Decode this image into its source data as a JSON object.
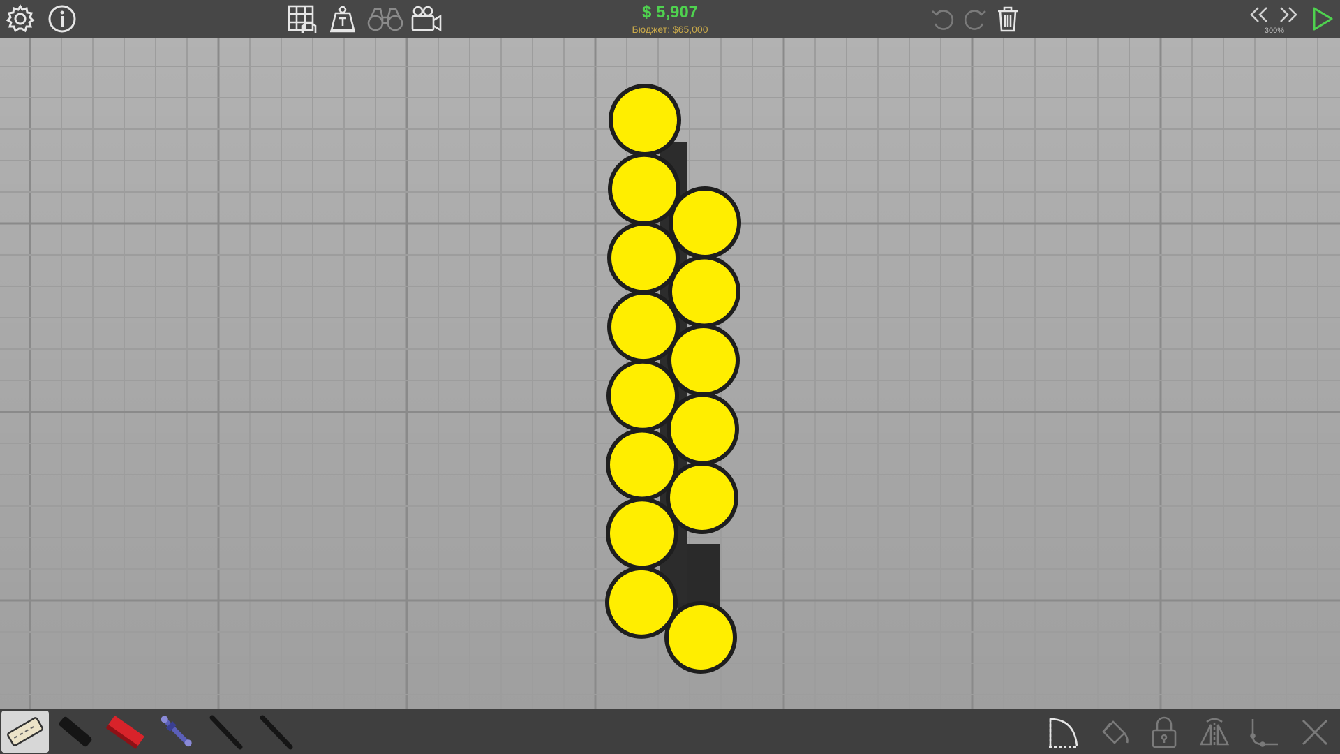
{
  "top_bar": {
    "money": "$ 5,907",
    "budget": "Бюджет: $65,000",
    "zoom": "300%",
    "icons": {
      "settings": "gear-icon",
      "info": "info-icon",
      "grid": "grid-icon",
      "weight": "weight-icon",
      "binoculars": "binoculars-icon",
      "camera": "video-camera-icon",
      "undo": "undo-icon",
      "redo": "redo-icon",
      "delete": "trash-icon",
      "rewind": "rewind-icon",
      "fast_forward": "fast-forward-icon",
      "play": "play-icon"
    }
  },
  "bottom_bar": {
    "materials": [
      "road",
      "reinforced-road",
      "steel-beam",
      "hydraulic",
      "rope",
      "cable"
    ],
    "tools": [
      "arc-tool-icon",
      "paint-bucket-icon",
      "lock-icon",
      "mirror-icon",
      "spline-icon",
      "close-icon"
    ]
  },
  "colors": {
    "top_bar": "#474747",
    "bottom_bar": "#3f3f3f",
    "grid_bg": "#a9a9a9",
    "node_fill": "#ffee00",
    "node_stroke": "#1e1e1e",
    "money_green": "#4fd24f",
    "budget_gold": "#c9a94a",
    "play_green": "#4fd24f"
  }
}
